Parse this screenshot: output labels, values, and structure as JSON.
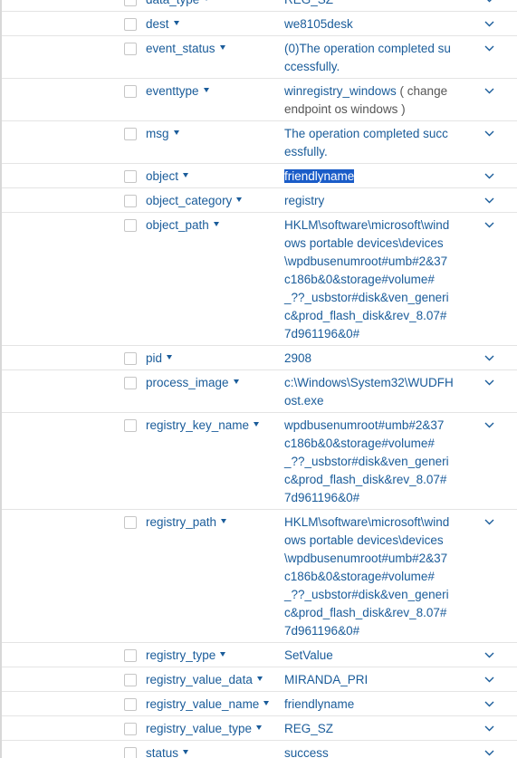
{
  "fields": [
    {
      "name": "data_type",
      "value": "REG_SZ",
      "lines": 1
    },
    {
      "name": "dest",
      "value": "we8105desk",
      "lines": 1
    },
    {
      "name": "event_status",
      "value": "(0)The operation completed successfully.",
      "value_lines": [
        "(0)The operation completed su",
        "ccessfully."
      ],
      "lines": 2
    },
    {
      "name": "eventtype",
      "value": "winregistry_windows",
      "value_sub": "( change  endpoint  os  windows )",
      "value_lines": [
        "winregistry_windows",
        "( change",
        " endpoint  os  windows )"
      ],
      "lines": 2
    },
    {
      "name": "msg",
      "value": "The operation completed successfully.",
      "value_lines": [
        "The operation completed succ",
        "essfully."
      ],
      "lines": 2
    },
    {
      "name": "object",
      "value": "friendlyname",
      "selected": true,
      "lines": 1
    },
    {
      "name": "object_category",
      "value": "registry",
      "lines": 1
    },
    {
      "name": "object_path",
      "value": "HKLM\\software\\microsoft\\windows portable devices\\devices\\wpdbusenumroot#umb#2&37c186b&0&storage#volume#_??_usbstor#disk&ven_generic&prod_flash_disk&rev_8.07#7d961196&0#",
      "value_lines": [
        "HKLM\\software\\microsoft\\wind",
        "ows portable devices\\devices",
        "\\wpdbusenumroot#umb#2&37",
        "c186b&0&storage#volume#",
        "_??_usbstor#disk&ven_generi",
        "c&prod_flash_disk&rev_8.07#",
        "7d961196&0#"
      ],
      "lines": 7
    },
    {
      "name": "pid",
      "value": "2908",
      "lines": 1
    },
    {
      "name": "process_image",
      "value": "c:\\Windows\\System32\\WUDFHost.exe",
      "value_lines": [
        "c:\\Windows\\System32\\WUDFH",
        "ost.exe"
      ],
      "lines": 2
    },
    {
      "name": "registry_key_name",
      "value": "wpdbusenumroot#umb#2&37c186b&0&storage#volume#_??_usbstor#disk&ven_generic&prod_flash_disk&rev_8.07#7d961196&0#",
      "value_lines": [
        "wpdbusenumroot#umb#2&37",
        "c186b&0&storage#volume#",
        "_??_usbstor#disk&ven_generi",
        "c&prod_flash_disk&rev_8.07#",
        "7d961196&0#"
      ],
      "lines": 5
    },
    {
      "name": "registry_path",
      "value": "HKLM\\software\\microsoft\\windows portable devices\\devices\\wpdbusenumroot#umb#2&37c186b&0&storage#volume#_??_usbstor#disk&ven_generic&prod_flash_disk&rev_8.07#7d961196&0#",
      "value_lines": [
        "HKLM\\software\\microsoft\\wind",
        "ows portable devices\\devices",
        "\\wpdbusenumroot#umb#2&37",
        "c186b&0&storage#volume#",
        "_??_usbstor#disk&ven_generi",
        "c&prod_flash_disk&rev_8.07#",
        "7d961196&0#"
      ],
      "lines": 7
    },
    {
      "name": "registry_type",
      "value": "SetValue",
      "lines": 1
    },
    {
      "name": "registry_value_data",
      "value": "MIRANDA_PRI",
      "lines": 1
    },
    {
      "name": "registry_value_name",
      "value": "friendlyname",
      "lines": 1
    },
    {
      "name": "registry_value_type",
      "value": "REG_SZ",
      "lines": 1
    },
    {
      "name": "status",
      "value": "success",
      "lines": 1
    }
  ],
  "icons": {
    "caret": "caret-down-icon",
    "expand": "chevron-down-icon"
  },
  "colors": {
    "link": "#1a5c9a",
    "selection": "#1a5cc8"
  }
}
